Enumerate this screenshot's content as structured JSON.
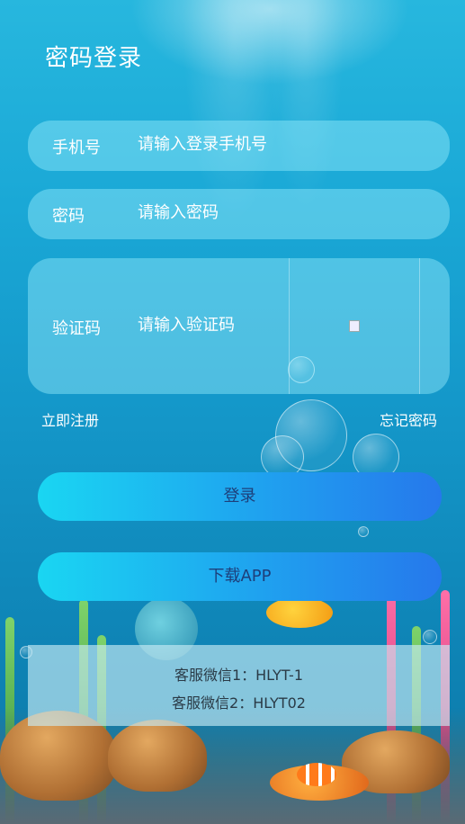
{
  "page": {
    "title": "密码登录"
  },
  "form": {
    "phone": {
      "label": "手机号",
      "placeholder": "请输入登录手机号"
    },
    "password": {
      "label": "密码",
      "placeholder": "请输入密码"
    },
    "captcha": {
      "label": "验证码",
      "placeholder": "请输入验证码"
    }
  },
  "links": {
    "register": "立即注册",
    "forgot": "忘记密码"
  },
  "buttons": {
    "login": "登录",
    "download": "下载APP"
  },
  "service": {
    "line1": "客服微信1：HLYT-1",
    "line2": "客服微信2：HLYT02"
  },
  "colors": {
    "background": "#1aa8d6",
    "button_start": "#1ad6f2",
    "button_end": "#2678ec",
    "button_text": "#1d3f7a"
  }
}
